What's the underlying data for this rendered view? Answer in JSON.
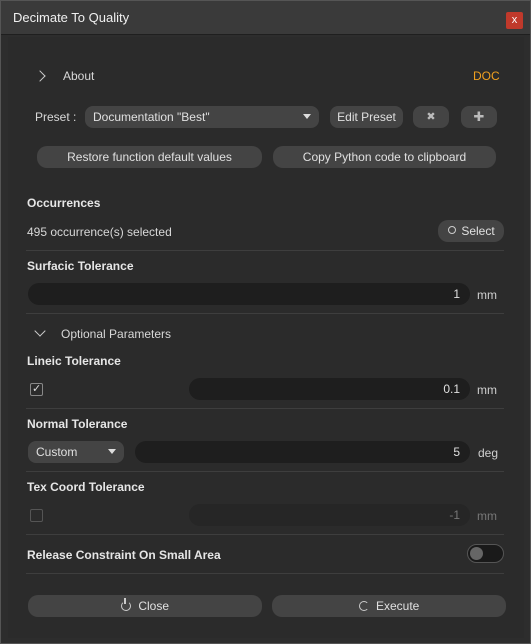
{
  "window": {
    "title": "Decimate To Quality",
    "close_glyph": "x"
  },
  "about": {
    "label": "About",
    "doc_label": "DOC"
  },
  "preset": {
    "label": "Preset :",
    "selected": "Documentation \"Best\"",
    "edit_label": "Edit Preset",
    "remove_glyph": "✖",
    "add_glyph": "✚"
  },
  "actions": {
    "restore_label": "Restore function default values",
    "copy_label": "Copy Python code to clipboard"
  },
  "occurrences": {
    "title": "Occurrences",
    "summary": "495 occurrence(s) selected",
    "select_label": "Select",
    "select_icon": "search-icon"
  },
  "surfacic": {
    "title": "Surfacic Tolerance",
    "value": "1",
    "unit": "mm"
  },
  "optional": {
    "label": "Optional Parameters",
    "expanded": true
  },
  "lineic": {
    "title": "Lineic Tolerance",
    "enabled": true,
    "value": "0.1",
    "unit": "mm"
  },
  "normal": {
    "title": "Normal Tolerance",
    "mode": "Custom",
    "value": "5",
    "unit": "deg"
  },
  "texcoord": {
    "title": "Tex Coord Tolerance",
    "enabled": false,
    "value": "-1",
    "unit": "mm"
  },
  "release": {
    "title": "Release Constraint On Small Area",
    "on": false
  },
  "footer": {
    "close_label": "Close",
    "close_icon": "power-icon",
    "execute_label": "Execute",
    "execute_icon": "refresh-icon"
  }
}
